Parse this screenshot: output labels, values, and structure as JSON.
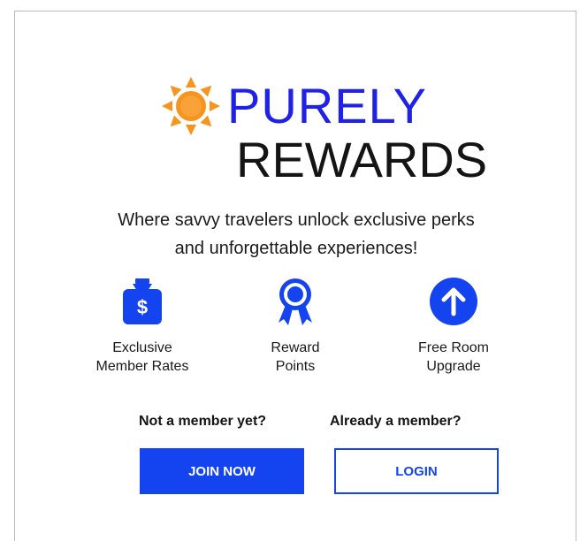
{
  "brand": {
    "name_top": "PURELY",
    "name_bottom": "REWARDS",
    "logo_icon": "sun-icon",
    "colors": {
      "primary_blue": "#1f22e6",
      "sun_orange": "#f7941d",
      "button_blue": "#1443f0"
    }
  },
  "tagline": {
    "line1": "Where savvy travelers unlock exclusive perks",
    "line2": "and unforgettable experiences!"
  },
  "features": [
    {
      "icon": "money-bag-icon",
      "line1": "Exclusive",
      "line2": "Member Rates"
    },
    {
      "icon": "award-ribbon-icon",
      "line1": "Reward",
      "line2": "Points"
    },
    {
      "icon": "arrow-up-circle-icon",
      "line1": "Free Room",
      "line2": "Upgrade"
    }
  ],
  "cta": {
    "join_question": "Not a member yet?",
    "join_label": "JOIN NOW",
    "login_question": "Already a member?",
    "login_label": "LOGIN"
  }
}
